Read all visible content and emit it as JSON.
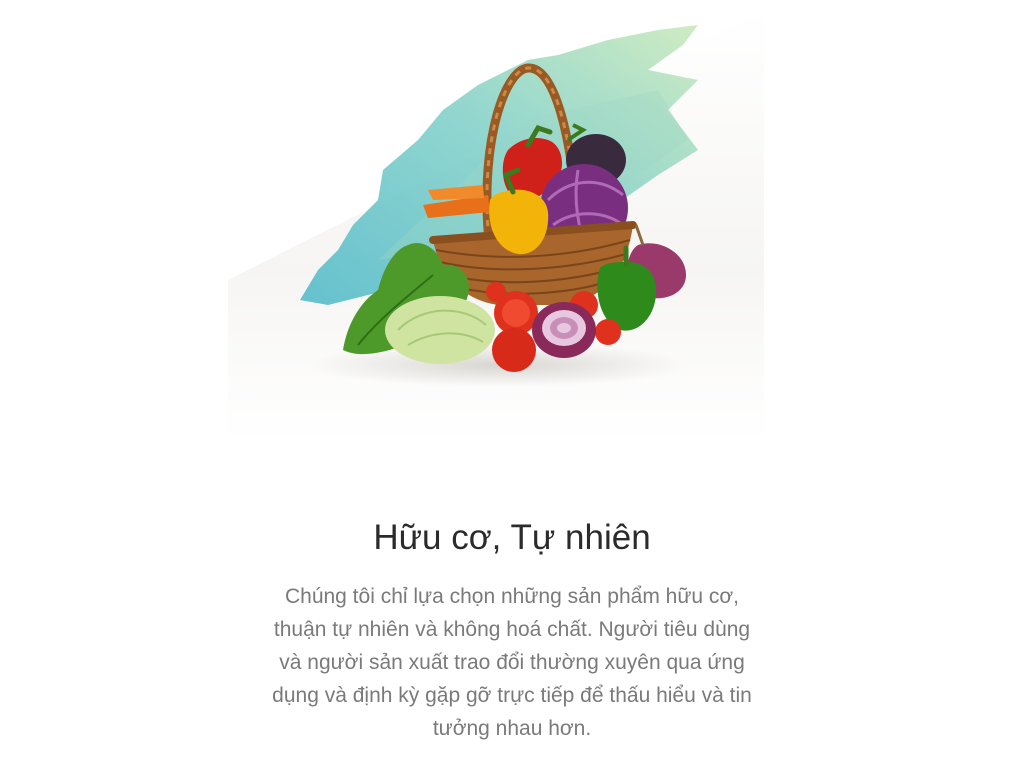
{
  "hero": {
    "image_alt": "Giỏ rau củ quả hữu cơ",
    "palette": {
      "teal": "#5ec4cc",
      "mint": "#a8dcb8",
      "wicker": "#a8662c",
      "red_pepper": "#d0201a",
      "yellow_pepper": "#f2b408",
      "green_pepper": "#2e8a1a",
      "red_cabbage": "#7a2e80",
      "lettuce": "#4d9a2a",
      "cabbage": "#cfe4a0",
      "tomato": "#e0301e",
      "onion": "#9a3a6a",
      "eggplant": "#3a2a3e",
      "carrot": "#e8701a"
    }
  },
  "feature": {
    "title": "Hữu cơ, Tự nhiên",
    "description": "Chúng tôi chỉ lựa chọn những sản phẩm hữu cơ, thuận tự nhiên và không hoá chất. Người tiêu dùng và người sản xuất trao đổi thường xuyên qua ứng dụng và định kỳ gặp gỡ trực tiếp để thấu hiểu và tin tưởng nhau hơn."
  }
}
